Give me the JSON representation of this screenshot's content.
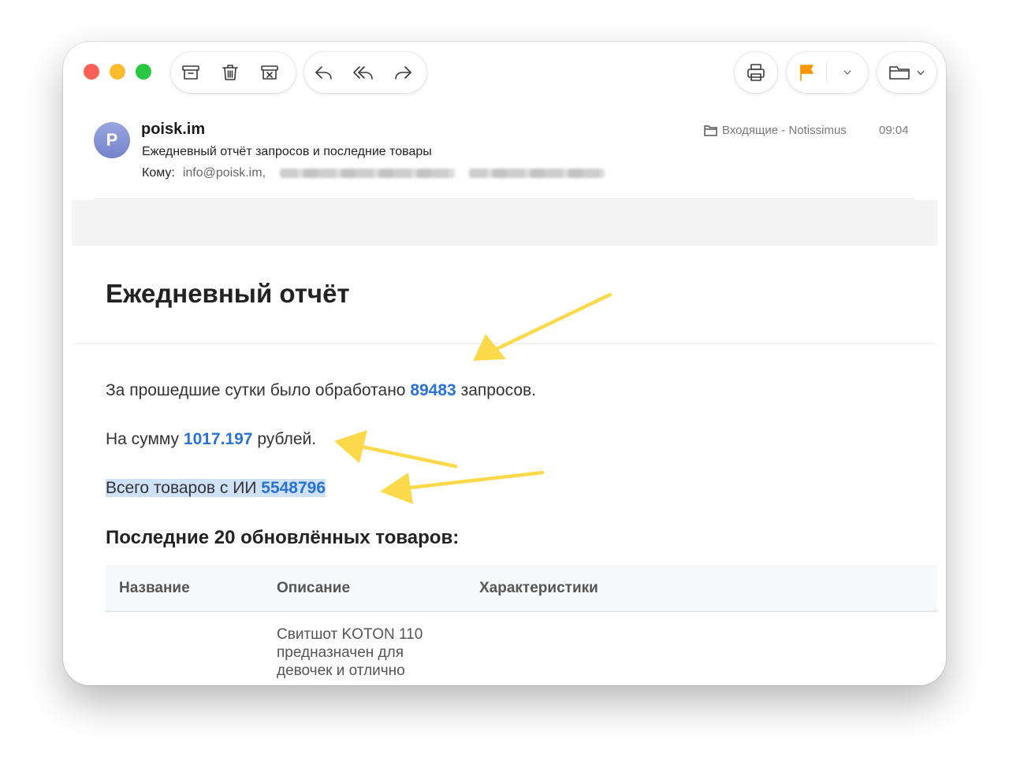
{
  "toolbar": {
    "archive": "archive-icon",
    "trash": "trash-icon",
    "junk": "junk-icon",
    "reply": "reply-icon",
    "reply_all": "reply-all-icon",
    "forward": "forward-icon",
    "print": "print-icon",
    "flag": "flag-icon",
    "flag_color": "#ff9500",
    "move": "folder-icon"
  },
  "message": {
    "avatar_initial": "P",
    "sender": "poisk.im",
    "subject": "Ежедневный отчёт запросов и последние товары",
    "to_label": "Кому:",
    "to_address": "info@poisk.im,",
    "mailbox": "Входящие - Notissimus",
    "time": "09:04"
  },
  "body": {
    "title": "Ежедневный отчёт",
    "line1_prefix": "За прошедшие сутки было обработано ",
    "line1_value": "89483",
    "line1_suffix": " запросов.",
    "line2_prefix": "На сумму ",
    "line2_value": "1017.197",
    "line2_suffix": " рублей.",
    "line3_prefix": "Всего товаров с ИИ ",
    "line3_value": "5548796",
    "section_title": "Последние 20 обновлённых товаров:",
    "table": {
      "headers": [
        "Название",
        "Описание",
        "Характеристики"
      ],
      "rows": [
        {
          "name": "",
          "description": "Свитшот KOTON 110 предназначен для девочек и отлично",
          "specs": ""
        }
      ]
    }
  },
  "colors": {
    "accent_number": "#2a72d4",
    "annotation_arrow": "#fcd94a",
    "highlight": "#cfe1f7"
  }
}
